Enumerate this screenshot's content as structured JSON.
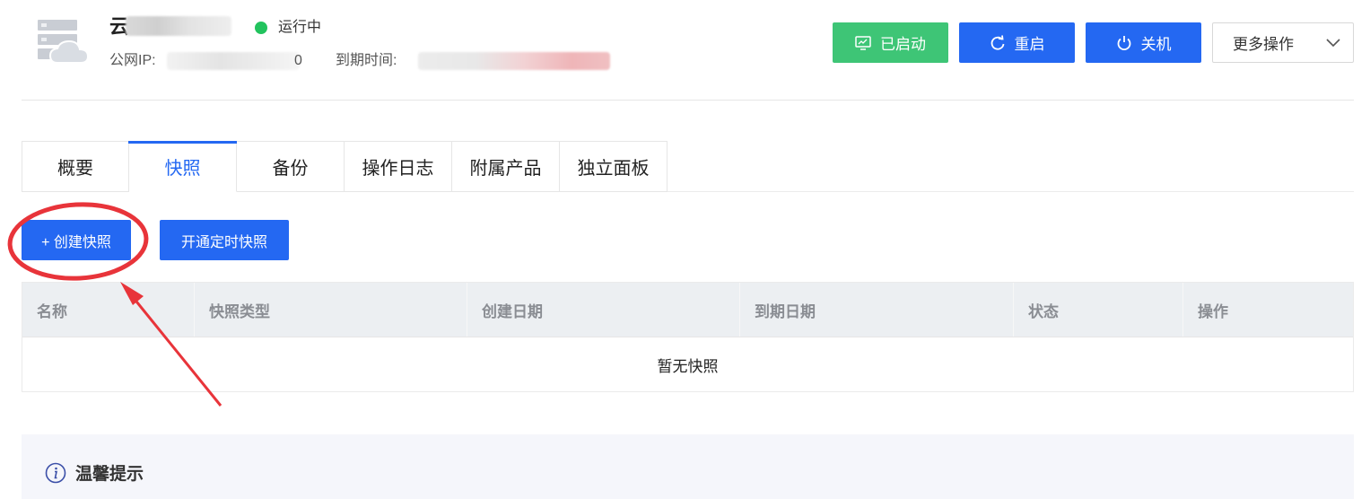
{
  "header": {
    "server_icon": "cloud-server-icon",
    "server_name_prefix": "云",
    "status_text": "运行中",
    "status_color": "#22c35e",
    "ip_label": "公网IP:",
    "ip_tail": "0",
    "expire_label": "到期时间:"
  },
  "toolbar": {
    "started_label": "已启动",
    "restart_label": "重启",
    "shutdown_label": "关机",
    "more_label": "更多操作"
  },
  "tabs": [
    {
      "label": "概要",
      "active": false
    },
    {
      "label": "快照",
      "active": true
    },
    {
      "label": "备份",
      "active": false
    },
    {
      "label": "操作日志",
      "active": false
    },
    {
      "label": "附属产品",
      "active": false
    },
    {
      "label": "独立面板",
      "active": false
    }
  ],
  "actions": {
    "create_label": "+ 创建快照",
    "schedule_label": "开通定时快照"
  },
  "table": {
    "columns": [
      "名称",
      "快照类型",
      "创建日期",
      "到期日期",
      "状态",
      "操作"
    ],
    "empty_text": "暂无快照"
  },
  "tips": {
    "title": "温馨提示"
  },
  "colors": {
    "primary": "#2468f2",
    "success": "#3ec576",
    "annotation": "#e8343a"
  }
}
